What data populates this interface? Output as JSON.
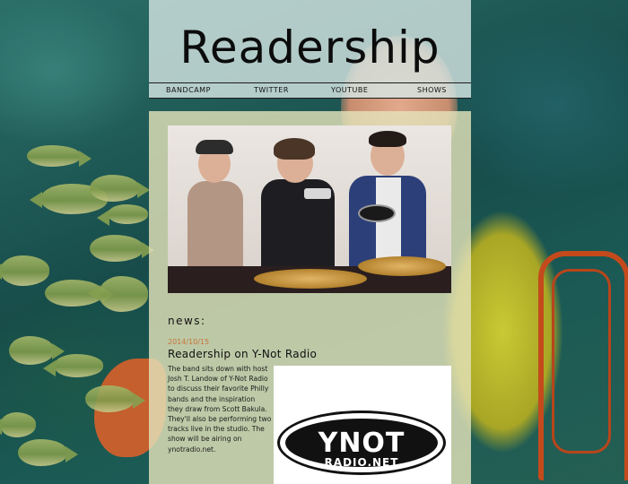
{
  "site": {
    "title": "Readership"
  },
  "nav": {
    "items": [
      {
        "label": "BANDCAMP"
      },
      {
        "label": "TWITTER"
      },
      {
        "label": "YOUTUBE"
      },
      {
        "label": "SHOWS"
      }
    ]
  },
  "news": {
    "heading": "news:",
    "posts": [
      {
        "date": "2014/10/15",
        "title": "Readership on Y-Not Radio",
        "body": "The band sits down with host Josh T. Landow of Y-Not Radio to discuss their favorite Philly bands and the inspiration they draw from Scott Bakula. They'll also be performing two tracks live in the studio. The show will be airing on ynotradio.net.",
        "image": {
          "logo_main": "YNOT",
          "logo_sub": "RADIO.NET"
        }
      }
    ]
  },
  "colors": {
    "accent_date": "#c8743a",
    "panel_header": "#d6e6e4",
    "panel_content": "#e2e2ba",
    "text": "#111111"
  }
}
